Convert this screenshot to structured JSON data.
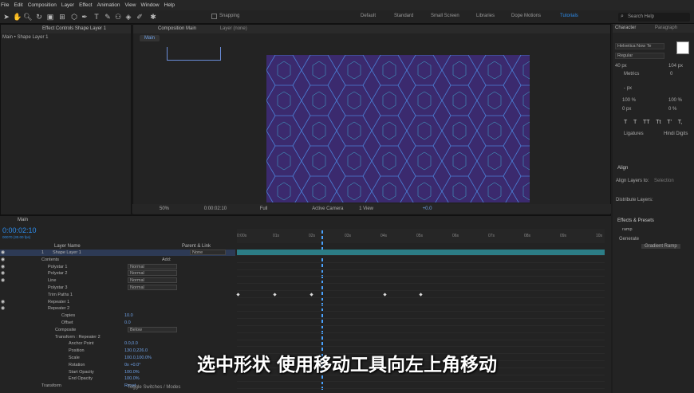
{
  "menu": [
    "File",
    "Edit",
    "Composition",
    "Layer",
    "Effect",
    "Animation",
    "View",
    "Window",
    "Help"
  ],
  "toolbar": {
    "snapping": "Snapping",
    "workspaces": [
      "Default",
      "Standard",
      "Small Screen",
      "Libraries",
      "Dope Motions",
      "Tutorials"
    ],
    "search": "Search Help"
  },
  "left_panel": {
    "tab": "Effect Controls Shape Layer 1",
    "breadcrumb": "Main • Shape Layer 1"
  },
  "comp_panel": {
    "tab": "Composition Main",
    "layer_tab": "Layer (none)",
    "main_chip": "Main"
  },
  "comp_bar": {
    "zoom": "50%",
    "time": "0:00:02:10",
    "res": "Full",
    "camera": "Active Camera",
    "views": "1 View",
    "offset": "+0.0"
  },
  "timeline": {
    "tab": "Main",
    "timecode": "0:00:02:10",
    "frames": "00070 (30.00 fps)",
    "col_layer": "Layer Name",
    "col_parent": "Parent & Link",
    "ruler": [
      "0:00s",
      "01s",
      "02s",
      "03s",
      "04s",
      "05s",
      "06s",
      "07s",
      "08s",
      "09s",
      "10s"
    ],
    "footer": "Toggle Switches / Modes"
  },
  "layers": [
    {
      "name": "Shape Layer 1",
      "num": "1",
      "parent": "None",
      "indent": 66
    },
    {
      "name": "Contents",
      "indent": 52,
      "add": "Add:"
    },
    {
      "name": "Polystar 1",
      "indent": 60,
      "mode": "Normal"
    },
    {
      "name": "Polystar 2",
      "indent": 60,
      "mode": "Normal"
    },
    {
      "name": "Line",
      "indent": 60,
      "mode": "Normal"
    },
    {
      "name": "Polystar 3",
      "indent": 60,
      "mode": "Normal"
    },
    {
      "name": "Trim Paths 1",
      "indent": 60
    },
    {
      "name": "Repeater 1",
      "indent": 60
    },
    {
      "name": "Repeater 2",
      "indent": 60
    },
    {
      "name": "Copies",
      "indent": 77,
      "value": "10.0"
    },
    {
      "name": "Offset",
      "indent": 77,
      "value": "0.0"
    },
    {
      "name": "Composite",
      "indent": 69,
      "mode": "Below"
    },
    {
      "name": "Transform : Repeater 2",
      "indent": 69
    },
    {
      "name": "Anchor Point",
      "indent": 86,
      "value": "0.0,0.0"
    },
    {
      "name": "Position",
      "indent": 86,
      "value": "130.0,226.0"
    },
    {
      "name": "Scale",
      "indent": 86,
      "value": "100.0,100.0%"
    },
    {
      "name": "Rotation",
      "indent": 86,
      "value": "0x +0.0°"
    },
    {
      "name": "Start Opacity",
      "indent": 86,
      "value": "100.0%"
    },
    {
      "name": "End Opacity",
      "indent": 86,
      "value": "100.0%"
    },
    {
      "name": "Transform",
      "indent": 52,
      "value": "Reset"
    }
  ],
  "character": {
    "tab": "Character",
    "tab2": "Paragraph",
    "font": "Helvetica Now Te",
    "style": "Regular",
    "size": "40 px",
    "leading": "104 px",
    "kerning": "Metrics",
    "tracking": "0",
    "vscale": "100 %",
    "hscale": "100 %",
    "baseline": "0 px",
    "tsume": "0 %",
    "stroke": "- px",
    "styles": [
      "T",
      "T",
      "TT",
      "Tt",
      "T'",
      "T,"
    ],
    "ligatures": "Ligatures",
    "hindi": "Hindi Digits"
  },
  "align": {
    "title": "Align",
    "align_to": "Align Layers to:",
    "selection": "Selection",
    "distribute": "Distribute Layers:"
  },
  "effects": {
    "title": "Effects & Presets",
    "search": "ramp",
    "group": "Generate",
    "item": "Gradient Ramp"
  },
  "subtitle": "选中形状 使用移动工具向左上角移动",
  "colors": {
    "accent": "#2d8ceb",
    "viewer": "#3b2a6e",
    "hex": "#3fb4d4"
  }
}
